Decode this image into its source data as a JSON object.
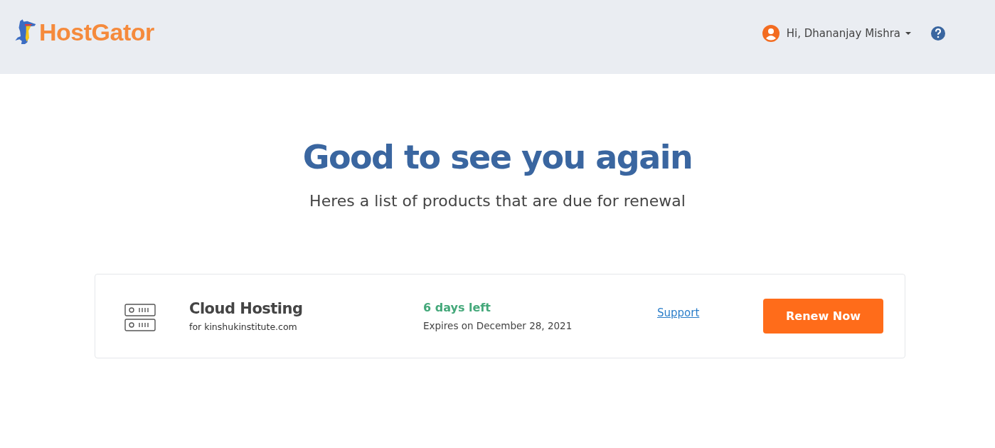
{
  "header": {
    "logo_text": "HostGator",
    "user_menu": {
      "label": "Hi, Dhananjay Mishra"
    }
  },
  "heading": "Good to see you again",
  "subheading": "Heres a list of products that are due for renewal",
  "products": [
    {
      "name": "Cloud Hosting",
      "domain": "for kinshukinstitute.com",
      "days_left": "6 days left",
      "expires": "Expires on December 28, 2021",
      "support_link": "Support",
      "action": "Renew Now"
    }
  ]
}
